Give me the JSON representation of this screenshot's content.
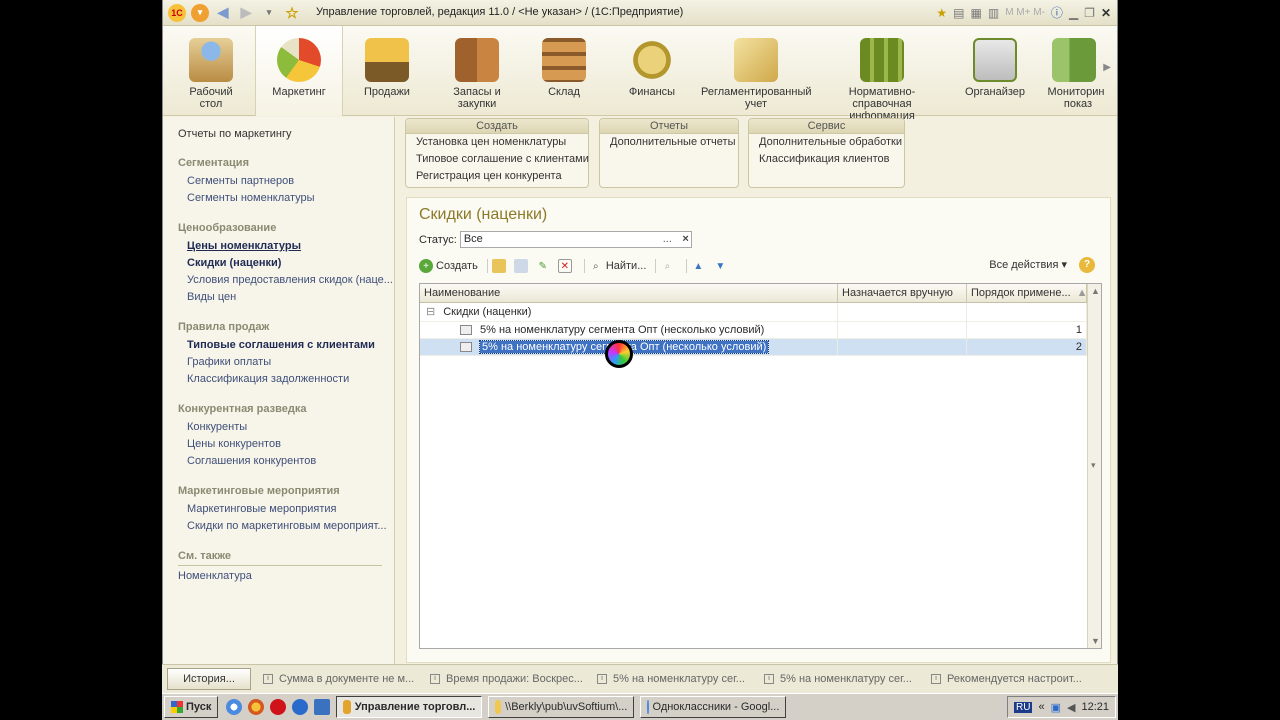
{
  "window": {
    "title": "Управление торговлей, редакция 11.0 / <Не указан> / (1С:Предприятие)",
    "app_badge": "1С",
    "mem_buttons": "M  M+  M-"
  },
  "sections": [
    {
      "label": "Рабочий стол",
      "color": "#c9a25b"
    },
    {
      "label": "Маркетинг",
      "color": "#e2a42c"
    },
    {
      "label": "Продажи",
      "color": "#8b7a3d"
    },
    {
      "label": "Запасы и закупки",
      "color": "#a0622d"
    },
    {
      "label": "Склад",
      "color": "#b56b2b"
    },
    {
      "label": "Финансы",
      "color": "#c9b04a"
    },
    {
      "label": "Регламентированный учет",
      "color": "#d4b45a"
    },
    {
      "label": "Нормативно-справочная информация",
      "color": "#7c9a2a"
    },
    {
      "label": "Органайзер",
      "color": "#8fae5a"
    },
    {
      "label": "Мониторинг показ",
      "color": "#9bc36a"
    }
  ],
  "leftnav": {
    "top_link": "Отчеты по маркетингу",
    "groups": [
      {
        "head": "Сегментация",
        "items": [
          {
            "label": "Сегменты партнеров"
          },
          {
            "label": "Сегменты номенклатуры"
          }
        ]
      },
      {
        "head": "Ценообразование",
        "items": [
          {
            "label": "Цены номенклатуры"
          },
          {
            "label": "Скидки (наценки)"
          },
          {
            "label": "Условия предоставления скидок (наце..."
          },
          {
            "label": "Виды цен"
          }
        ]
      },
      {
        "head": "Правила продаж",
        "items": [
          {
            "label": "Типовые соглашения с клиентами"
          },
          {
            "label": "Графики оплаты"
          },
          {
            "label": "Классификация задолженности"
          }
        ]
      },
      {
        "head": "Конкурентная разведка",
        "items": [
          {
            "label": "Конкуренты"
          },
          {
            "label": "Цены конкурентов"
          },
          {
            "label": "Соглашения конкурентов"
          }
        ]
      },
      {
        "head": "Маркетинговые мероприятия",
        "items": [
          {
            "label": "Маркетинговые мероприятия"
          },
          {
            "label": "Скидки по маркетинговым мероприят..."
          }
        ]
      }
    ],
    "see_also": {
      "head": "См. также",
      "item": "Номенклатура"
    }
  },
  "commands": [
    {
      "head": "Создать",
      "items": [
        "Установка цен номенклатуры",
        "Типовое соглашение с клиентами",
        "Регистрация цен конкурента"
      ]
    },
    {
      "head": "Отчеты",
      "items": [
        "Дополнительные отчеты"
      ]
    },
    {
      "head": "Сервис",
      "items": [
        "Дополнительные обработки",
        "Классификация клиентов"
      ]
    }
  ],
  "form": {
    "title": "Скидки (наценки)",
    "status_label": "Статус:",
    "status_value": "Все",
    "status_dots": "...",
    "status_clear": "×",
    "create_label": "Создать",
    "find_label": "Найти...",
    "all_actions": "Все действия ▾",
    "help": "?"
  },
  "table": {
    "columns": [
      "Наименование",
      "Назначается вручную",
      "Порядок примене..."
    ],
    "group_row": "Скидки (наценки)",
    "rows": [
      {
        "name": "5% на номенклатуру сегмента Опт (несколько условий)",
        "manual": "",
        "order": "1"
      },
      {
        "name": "5% на номенклатуру сегмента Опт (несколько условий)",
        "manual": "",
        "order": "2"
      }
    ]
  },
  "history": {
    "button": "История...",
    "items": [
      "Сумма в документе не м...",
      "Время продажи: Воскрес...",
      "5% на номенклатуру сег...",
      "5% на номенклатуру сег...",
      "Рекомендуется настроит..."
    ]
  },
  "taskbar": {
    "start": "Пуск",
    "tasks": [
      {
        "label": "Управление торговл...",
        "color": "#e2a42c"
      },
      {
        "label": "\\\\Berkly\\pub\\uvSoftium\\...",
        "color": "#f0c850"
      },
      {
        "label": "Одноклассники - Googl...",
        "color": "#4a8ae0"
      }
    ],
    "lang": "RU",
    "clock": "12:21"
  }
}
